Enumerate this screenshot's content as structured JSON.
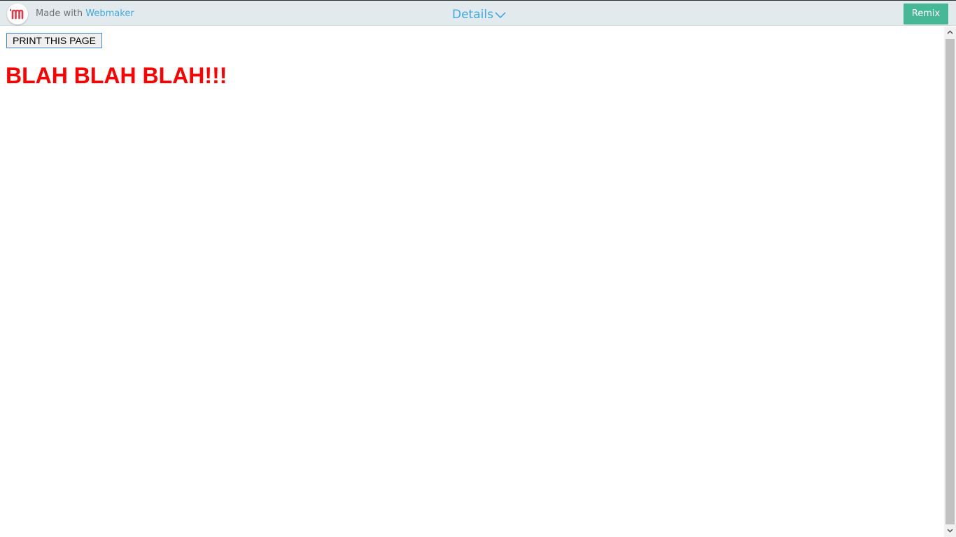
{
  "topbar": {
    "made_with": "Made with",
    "brand_link": "Webmaker",
    "details_label": "Details",
    "remix_label": "Remix",
    "colors": {
      "bar_bg": "#e3eaed",
      "link": "#3fa9e0",
      "remix_bg": "#46b896",
      "logo_letter": "#e03b4a"
    }
  },
  "page": {
    "print_button_label": "PRINT THIS PAGE",
    "headline": "BLAH BLAH BLAH!!!",
    "headline_color": "#ff0000"
  },
  "icons": {
    "logo": "webmaker-logo-icon",
    "details": "chevron-down-icon",
    "scroll_up": "scroll-up-arrow-icon",
    "scroll_down": "scroll-down-arrow-icon"
  }
}
